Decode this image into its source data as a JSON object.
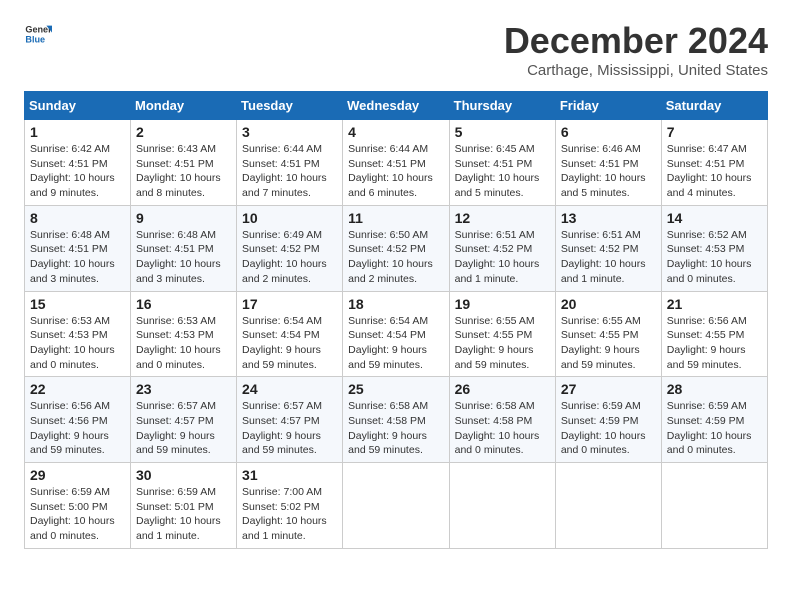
{
  "logo": {
    "text_general": "General",
    "text_blue": "Blue"
  },
  "title": "December 2024",
  "subtitle": "Carthage, Mississippi, United States",
  "header": {
    "days": [
      "Sunday",
      "Monday",
      "Tuesday",
      "Wednesday",
      "Thursday",
      "Friday",
      "Saturday"
    ]
  },
  "weeks": [
    [
      {
        "day": "1",
        "info": "Sunrise: 6:42 AM\nSunset: 4:51 PM\nDaylight: 10 hours\nand 9 minutes."
      },
      {
        "day": "2",
        "info": "Sunrise: 6:43 AM\nSunset: 4:51 PM\nDaylight: 10 hours\nand 8 minutes."
      },
      {
        "day": "3",
        "info": "Sunrise: 6:44 AM\nSunset: 4:51 PM\nDaylight: 10 hours\nand 7 minutes."
      },
      {
        "day": "4",
        "info": "Sunrise: 6:44 AM\nSunset: 4:51 PM\nDaylight: 10 hours\nand 6 minutes."
      },
      {
        "day": "5",
        "info": "Sunrise: 6:45 AM\nSunset: 4:51 PM\nDaylight: 10 hours\nand 5 minutes."
      },
      {
        "day": "6",
        "info": "Sunrise: 6:46 AM\nSunset: 4:51 PM\nDaylight: 10 hours\nand 5 minutes."
      },
      {
        "day": "7",
        "info": "Sunrise: 6:47 AM\nSunset: 4:51 PM\nDaylight: 10 hours\nand 4 minutes."
      }
    ],
    [
      {
        "day": "8",
        "info": "Sunrise: 6:48 AM\nSunset: 4:51 PM\nDaylight: 10 hours\nand 3 minutes."
      },
      {
        "day": "9",
        "info": "Sunrise: 6:48 AM\nSunset: 4:51 PM\nDaylight: 10 hours\nand 3 minutes."
      },
      {
        "day": "10",
        "info": "Sunrise: 6:49 AM\nSunset: 4:52 PM\nDaylight: 10 hours\nand 2 minutes."
      },
      {
        "day": "11",
        "info": "Sunrise: 6:50 AM\nSunset: 4:52 PM\nDaylight: 10 hours\nand 2 minutes."
      },
      {
        "day": "12",
        "info": "Sunrise: 6:51 AM\nSunset: 4:52 PM\nDaylight: 10 hours\nand 1 minute."
      },
      {
        "day": "13",
        "info": "Sunrise: 6:51 AM\nSunset: 4:52 PM\nDaylight: 10 hours\nand 1 minute."
      },
      {
        "day": "14",
        "info": "Sunrise: 6:52 AM\nSunset: 4:53 PM\nDaylight: 10 hours\nand 0 minutes."
      }
    ],
    [
      {
        "day": "15",
        "info": "Sunrise: 6:53 AM\nSunset: 4:53 PM\nDaylight: 10 hours\nand 0 minutes."
      },
      {
        "day": "16",
        "info": "Sunrise: 6:53 AM\nSunset: 4:53 PM\nDaylight: 10 hours\nand 0 minutes."
      },
      {
        "day": "17",
        "info": "Sunrise: 6:54 AM\nSunset: 4:54 PM\nDaylight: 9 hours\nand 59 minutes."
      },
      {
        "day": "18",
        "info": "Sunrise: 6:54 AM\nSunset: 4:54 PM\nDaylight: 9 hours\nand 59 minutes."
      },
      {
        "day": "19",
        "info": "Sunrise: 6:55 AM\nSunset: 4:55 PM\nDaylight: 9 hours\nand 59 minutes."
      },
      {
        "day": "20",
        "info": "Sunrise: 6:55 AM\nSunset: 4:55 PM\nDaylight: 9 hours\nand 59 minutes."
      },
      {
        "day": "21",
        "info": "Sunrise: 6:56 AM\nSunset: 4:55 PM\nDaylight: 9 hours\nand 59 minutes."
      }
    ],
    [
      {
        "day": "22",
        "info": "Sunrise: 6:56 AM\nSunset: 4:56 PM\nDaylight: 9 hours\nand 59 minutes."
      },
      {
        "day": "23",
        "info": "Sunrise: 6:57 AM\nSunset: 4:57 PM\nDaylight: 9 hours\nand 59 minutes."
      },
      {
        "day": "24",
        "info": "Sunrise: 6:57 AM\nSunset: 4:57 PM\nDaylight: 9 hours\nand 59 minutes."
      },
      {
        "day": "25",
        "info": "Sunrise: 6:58 AM\nSunset: 4:58 PM\nDaylight: 9 hours\nand 59 minutes."
      },
      {
        "day": "26",
        "info": "Sunrise: 6:58 AM\nSunset: 4:58 PM\nDaylight: 10 hours\nand 0 minutes."
      },
      {
        "day": "27",
        "info": "Sunrise: 6:59 AM\nSunset: 4:59 PM\nDaylight: 10 hours\nand 0 minutes."
      },
      {
        "day": "28",
        "info": "Sunrise: 6:59 AM\nSunset: 4:59 PM\nDaylight: 10 hours\nand 0 minutes."
      }
    ],
    [
      {
        "day": "29",
        "info": "Sunrise: 6:59 AM\nSunset: 5:00 PM\nDaylight: 10 hours\nand 0 minutes."
      },
      {
        "day": "30",
        "info": "Sunrise: 6:59 AM\nSunset: 5:01 PM\nDaylight: 10 hours\nand 1 minute."
      },
      {
        "day": "31",
        "info": "Sunrise: 7:00 AM\nSunset: 5:02 PM\nDaylight: 10 hours\nand 1 minute."
      },
      {
        "day": "",
        "info": ""
      },
      {
        "day": "",
        "info": ""
      },
      {
        "day": "",
        "info": ""
      },
      {
        "day": "",
        "info": ""
      }
    ]
  ]
}
